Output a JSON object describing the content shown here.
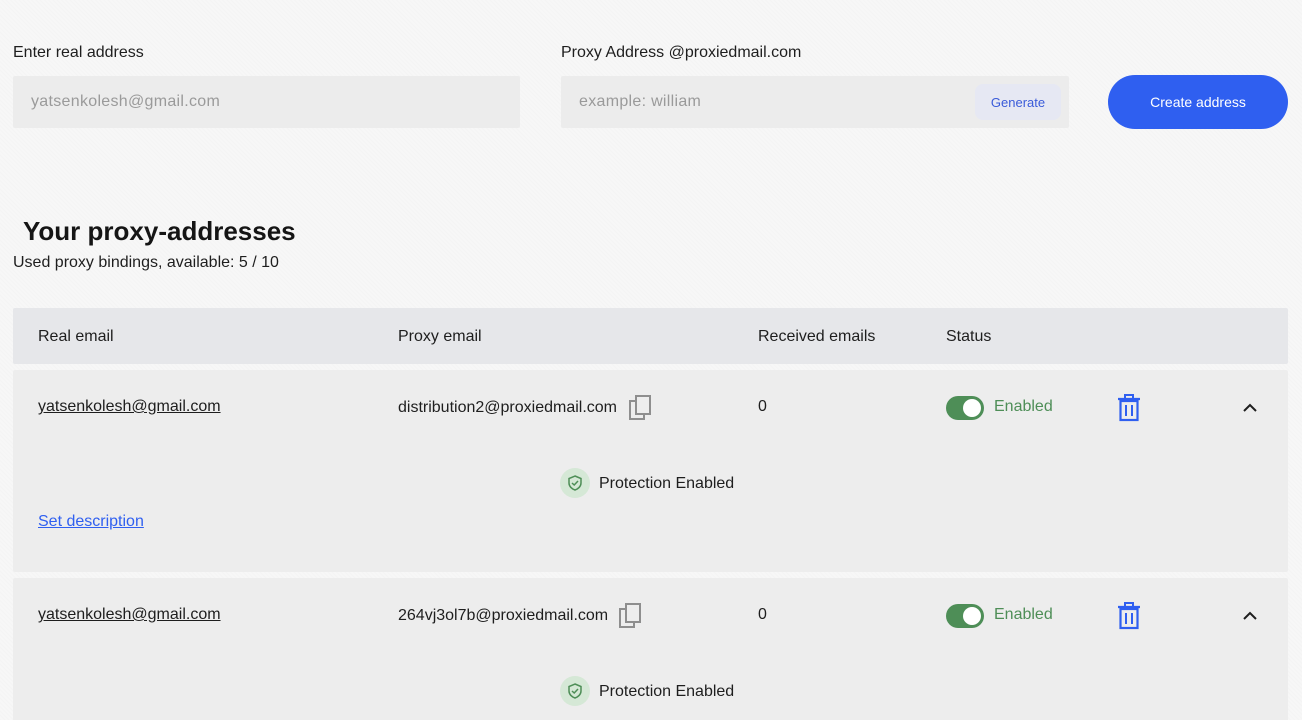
{
  "form": {
    "real_label": "Enter real address",
    "real_value": "",
    "real_placeholder": "yatsenkolesh@gmail.com",
    "proxy_label": "Proxy Address @proxiedmail.com",
    "proxy_value": "",
    "proxy_placeholder": "example: william",
    "generate_label": "Generate",
    "create_label": "Create address"
  },
  "section": {
    "title": "Your proxy-addresses",
    "subtitle": "Used proxy bindings, available: 5 / 10"
  },
  "table": {
    "headers": [
      "Real email",
      "Proxy email",
      "Received emails",
      "Status"
    ],
    "rows": [
      {
        "real_email": "yatsenkolesh@gmail.com",
        "proxy_email": "distribution2@proxiedmail.com",
        "received": "0",
        "status": "Enabled",
        "protection": "Protection Enabled",
        "description_link": "Set description"
      },
      {
        "real_email": "yatsenkolesh@gmail.com",
        "proxy_email": "264vj3ol7b@proxiedmail.com",
        "received": "0",
        "status": "Enabled",
        "protection": "Protection Enabled"
      }
    ]
  },
  "colors": {
    "accent": "#2f5ff0",
    "status_green": "#4e8e57",
    "row_bg": "#ededed",
    "header_bg": "#e6e7ea"
  },
  "icons": [
    "copy-icon",
    "trash-icon",
    "chevron-up-icon",
    "shield-check-icon"
  ]
}
